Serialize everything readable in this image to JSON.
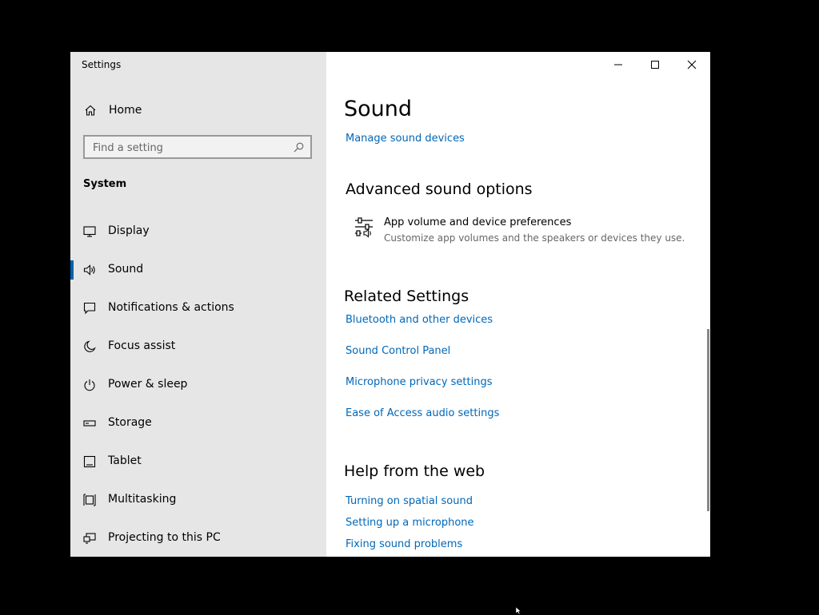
{
  "window": {
    "title": "Settings"
  },
  "sidebar": {
    "home_label": "Home",
    "search_placeholder": "Find a setting",
    "section_label": "System",
    "items": [
      {
        "label": "Display",
        "icon": "monitor-icon"
      },
      {
        "label": "Sound",
        "icon": "speaker-icon",
        "active": true
      },
      {
        "label": "Notifications & actions",
        "icon": "notification-icon"
      },
      {
        "label": "Focus assist",
        "icon": "moon-icon"
      },
      {
        "label": "Power & sleep",
        "icon": "power-icon"
      },
      {
        "label": "Storage",
        "icon": "storage-icon"
      },
      {
        "label": "Tablet",
        "icon": "tablet-icon"
      },
      {
        "label": "Multitasking",
        "icon": "multitasking-icon"
      },
      {
        "label": "Projecting to this PC",
        "icon": "projecting-icon"
      }
    ]
  },
  "main": {
    "title": "Sound",
    "manage_link": "Manage sound devices",
    "advanced": {
      "heading": "Advanced sound options",
      "item_title": "App volume and device preferences",
      "item_desc": "Customize app volumes and the speakers or devices they use."
    },
    "related": {
      "heading": "Related Settings",
      "links": [
        "Bluetooth and other devices",
        "Sound Control Panel",
        "Microphone privacy settings",
        "Ease of Access audio settings"
      ]
    },
    "help": {
      "heading": "Help from the web",
      "links": [
        "Turning on spatial sound",
        "Setting up a microphone",
        "Fixing sound problems"
      ]
    }
  },
  "colors": {
    "accent": "#0063b1",
    "link": "#0067b8",
    "sidebar_bg": "#e6e6e6"
  }
}
